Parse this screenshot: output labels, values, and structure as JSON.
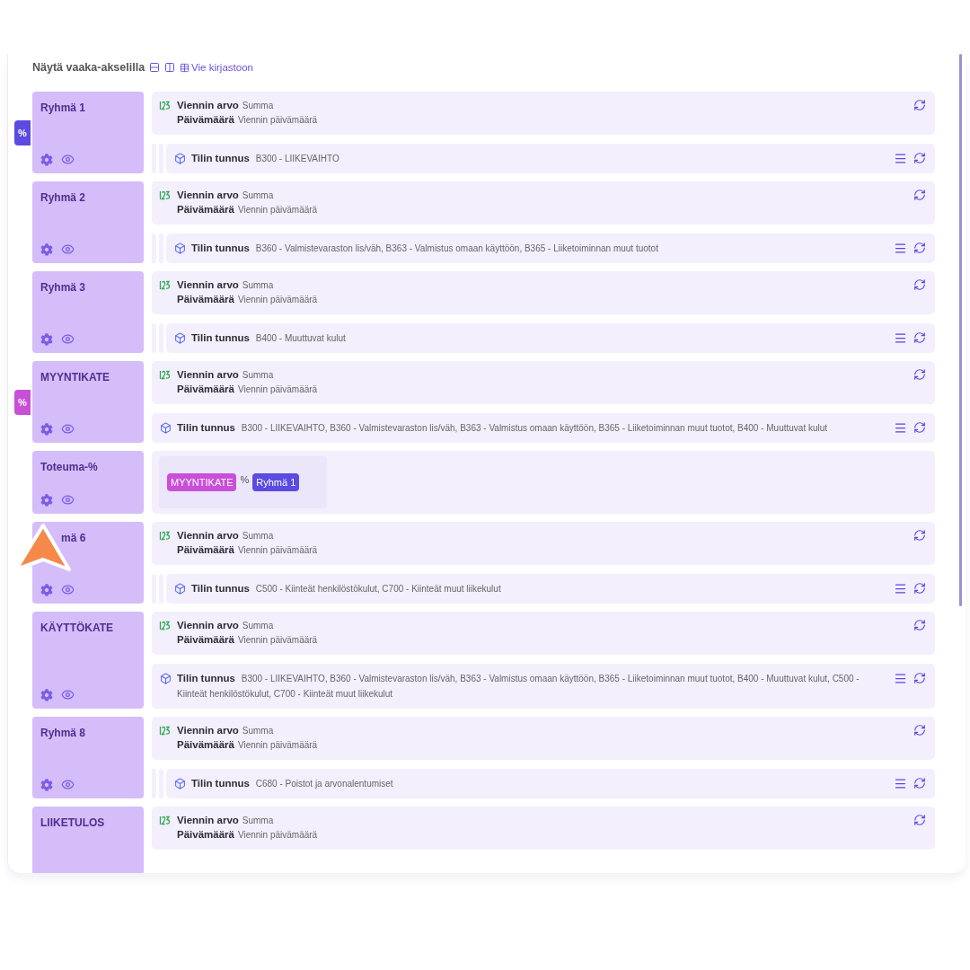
{
  "header": {
    "title": "Näytä vaaka-akselilla",
    "link": "Vie kirjastoon"
  },
  "groups": [
    {
      "kind": "measure",
      "name": "Ryhmä 1",
      "tag": {
        "label": "%",
        "color": "#5b4be0"
      },
      "measure": {
        "label": "Viennin arvo",
        "value": "Summa",
        "date_label": "Päivämäärä",
        "date_value": "Viennin päivämäärä"
      },
      "dimension": {
        "label": "Tilin tunnus",
        "value": "B300 - LIIKEVAIHTO",
        "nested": true
      }
    },
    {
      "kind": "measure",
      "name": "Ryhmä 2",
      "measure": {
        "label": "Viennin arvo",
        "value": "Summa",
        "date_label": "Päivämäärä",
        "date_value": "Viennin päivämäärä"
      },
      "dimension": {
        "label": "Tilin tunnus",
        "value": "B360 - Valmistevaraston lis/väh, B363 - Valmistus omaan käyttöön, B365 - Liiketoiminnan muut tuotot",
        "nested": true
      }
    },
    {
      "kind": "measure",
      "name": "Ryhmä 3",
      "measure": {
        "label": "Viennin arvo",
        "value": "Summa",
        "date_label": "Päivämäärä",
        "date_value": "Viennin päivämäärä"
      },
      "dimension": {
        "label": "Tilin tunnus",
        "value": "B400 - Muuttuvat kulut",
        "nested": true
      }
    },
    {
      "kind": "measure",
      "name": "MYYNTIKATE",
      "tag": {
        "label": "%",
        "color": "#c94fd8"
      },
      "measure": {
        "label": "Viennin arvo",
        "value": "Summa",
        "date_label": "Päivämäärä",
        "date_value": "Viennin päivämäärä"
      },
      "dimension": {
        "label": "Tilin tunnus",
        "value": "B300 - LIIKEVAIHTO, B360 - Valmistevaraston lis/väh, B363 - Valmistus omaan käyttöön, B365 - Liiketoiminnan muut tuotot, B400 - Muuttuvat kulut",
        "nested": false
      }
    },
    {
      "kind": "formula",
      "name": "Toteuma-%",
      "formula": {
        "left": {
          "label": "MYYNTIKATE",
          "color": "#c94fd8"
        },
        "operator": "%",
        "right": {
          "label": "Ryhmä 1",
          "color": "#5b4be0"
        }
      }
    },
    {
      "kind": "measure",
      "name": "mä 6",
      "measure": {
        "label": "Viennin arvo",
        "value": "Summa",
        "date_label": "Päivämäärä",
        "date_value": "Viennin päivämäärä"
      },
      "dimension": {
        "label": "Tilin tunnus",
        "value": "C500 - Kiinteät henkilöstökulut, C700 - Kiinteät muut liikekulut",
        "nested": true
      }
    },
    {
      "kind": "measure",
      "name": "KÄYTTÖKATE",
      "measure": {
        "label": "Viennin arvo",
        "value": "Summa",
        "date_label": "Päivämäärä",
        "date_value": "Viennin päivämäärä"
      },
      "dimension": {
        "label": "Tilin tunnus",
        "value": "B300 - LIIKEVAIHTO, B360 - Valmistevaraston lis/väh, B363 - Valmistus omaan käyttöön, B365 - Liiketoiminnan muut tuotot, B400 - Muuttuvat kulut, C500 - Kiinteät henkilöstökulut, C700 - Kiinteät muut liikekulut",
        "nested": false
      }
    },
    {
      "kind": "measure",
      "name": "Ryhmä 8",
      "measure": {
        "label": "Viennin arvo",
        "value": "Summa",
        "date_label": "Päivämäärä",
        "date_value": "Viennin päivämäärä"
      },
      "dimension": {
        "label": "Tilin tunnus",
        "value": "C680 - Poistot ja arvonalentumiset",
        "nested": true
      }
    },
    {
      "kind": "measure",
      "name": "LIIKETULOS",
      "measure": {
        "label": "Viennin arvo",
        "value": "Summa",
        "date_label": "Päivämäärä",
        "date_value": "Viennin päivämäärä"
      }
    }
  ]
}
